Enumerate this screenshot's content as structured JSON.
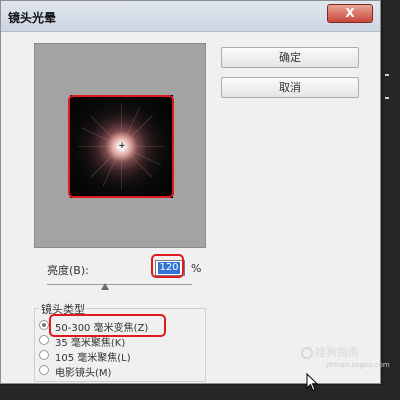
{
  "dialog": {
    "title": "镜头光晕",
    "close_label": "X",
    "ok_label": "确定",
    "cancel_label": "取消"
  },
  "preview": {
    "crosshair_icon": "+"
  },
  "brightness": {
    "label": "亮度(B):",
    "value": "120",
    "unit": "%",
    "slider_fraction": 0.4
  },
  "lens_type": {
    "group_label": "镜头类型",
    "options": [
      {
        "label": "50-300 毫米变焦(Z)",
        "selected": true
      },
      {
        "label": "35 毫米聚焦(K)",
        "selected": false
      },
      {
        "label": "105 毫米聚焦(L)",
        "selected": false
      },
      {
        "label": "电影镜头(M)",
        "selected": false
      }
    ]
  },
  "watermark": {
    "text": "搜狗指南",
    "sub": "zhinan.sogou.com"
  },
  "colors": {
    "highlight": "#e0191e",
    "selection": "#3374d6",
    "preview_bg": "#a3a3a3"
  }
}
